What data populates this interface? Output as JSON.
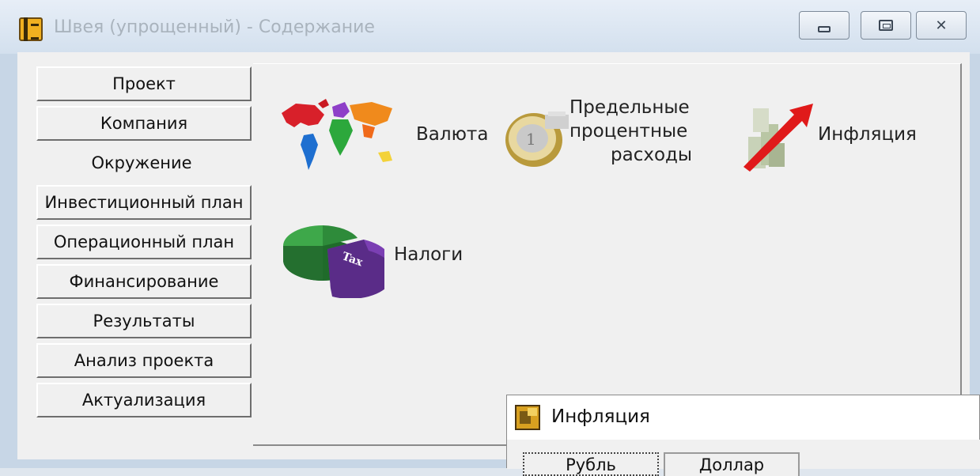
{
  "window": {
    "title": "Швея (упрощенный) - Содержание"
  },
  "sidebar": {
    "items": [
      {
        "label": "Проект"
      },
      {
        "label": "Компания"
      },
      {
        "label": "Окружение"
      },
      {
        "label": "Инвестиционный план"
      },
      {
        "label": "Операционный план"
      },
      {
        "label": "Финансирование"
      },
      {
        "label": "Результаты"
      },
      {
        "label": "Анализ проекта"
      },
      {
        "label": "Актуализация"
      }
    ],
    "active_index": 2
  },
  "panel": {
    "tiles": [
      {
        "label": "Валюта",
        "icon": "world-map-icon"
      },
      {
        "label_lines": [
          "Предельные",
          "процентные",
          "расходы"
        ],
        "icon": "euro-coin-icon"
      },
      {
        "label": "Инфляция",
        "icon": "money-rising-arrow-icon"
      },
      {
        "label": "Налоги",
        "icon": "tax-pie-chart-icon",
        "pie_text": "Tax"
      }
    ]
  },
  "dialog": {
    "title": "Инфляция",
    "tabs": [
      {
        "label": "Рубль"
      },
      {
        "label": "Доллар"
      }
    ]
  },
  "colors": {
    "window_frame": "#c7d6e6",
    "content_bg": "#f0f0f0",
    "arrow_red": "#e01a1a",
    "pie_green": "#2e8b3a",
    "pie_purple": "#7b3fb3"
  }
}
